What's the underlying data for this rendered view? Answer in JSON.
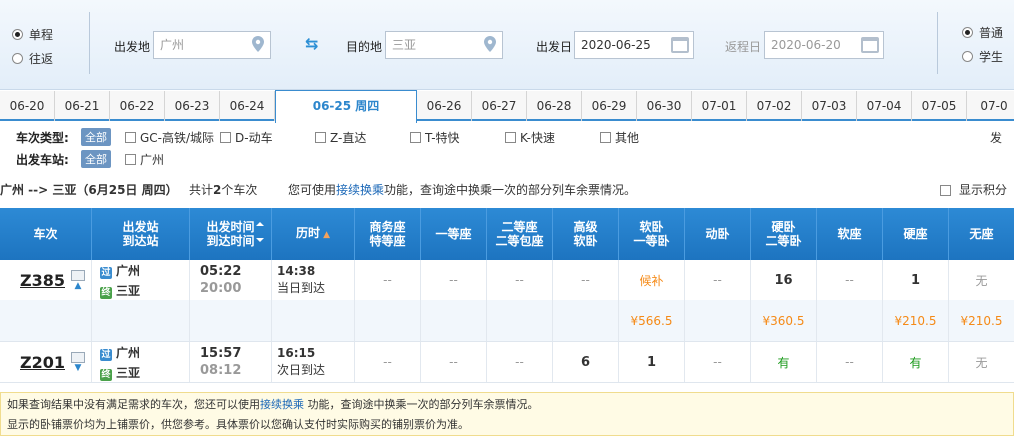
{
  "search": {
    "trip_oneway": "单程",
    "trip_round": "往返",
    "from_label": "出发地",
    "from_value": "广州",
    "to_label": "目的地",
    "to_value": "三亚",
    "depart_label": "出发日",
    "depart_value": "2020-06-25",
    "return_label": "返程日",
    "return_value": "2020-06-20",
    "type_normal": "普通",
    "type_student": "学生"
  },
  "date_tabs": [
    "06-20",
    "06-21",
    "06-22",
    "06-23",
    "06-24",
    "06-25 周四",
    "06-26",
    "06-27",
    "06-28",
    "06-29",
    "06-30",
    "07-01",
    "07-02",
    "07-03",
    "07-04",
    "07-05",
    "07-0"
  ],
  "filters": {
    "type_label": "车次类型:",
    "all": "全部",
    "types": [
      "GC-高铁/城际",
      "D-动车",
      "Z-直达",
      "T-特快",
      "K-快速",
      "其他"
    ],
    "right_cut": "发",
    "station_label": "出发车站:",
    "stations": [
      "广州"
    ]
  },
  "summary": {
    "route": "广州 --> 三亚（6月25日  周四）",
    "count_pre": "共计",
    "count": "2",
    "count_post": "个车次",
    "hint_pre": "您可使用",
    "hint_link": "接续换乘",
    "hint_post": "功能，查询途中换乘一次的部分列车余票情况。",
    "show_points": "显示积分"
  },
  "table": {
    "headers": {
      "train": "车次",
      "station1": "出发站",
      "station2": "到达站",
      "time1": "出发时间",
      "time2": "到达时间",
      "duration": "历时",
      "business1": "商务座",
      "business2": "特等座",
      "first": "一等座",
      "second1": "二等座",
      "second2": "二等包座",
      "highsoft1": "高级",
      "highsoft2": "软卧",
      "softsleep1": "软卧",
      "softsleep2": "一等卧",
      "dongwo": "动卧",
      "hardsleep1": "硬卧",
      "hardsleep2": "二等卧",
      "softseat": "软座",
      "hardseat": "硬座",
      "noseat": "无座"
    },
    "rows": [
      {
        "train": "Z385",
        "from": "广州",
        "to": "三亚",
        "dep": "05:22",
        "arr": "20:00",
        "duration": "14:38",
        "arrive_day": "当日到达",
        "business": "--",
        "first": "--",
        "second": "--",
        "highsoft": "--",
        "softsleep": "候补",
        "dongwo": "--",
        "hardsleep": "16",
        "softseat": "--",
        "hardseat": "1",
        "noseat": "无",
        "prices": {
          "softsleep": "¥566.5",
          "hardsleep": "¥360.5",
          "hardseat": "¥210.5",
          "noseat": "¥210.5"
        }
      },
      {
        "train": "Z201",
        "from": "广州",
        "to": "三亚",
        "dep": "15:57",
        "arr": "08:12",
        "duration": "16:15",
        "arrive_day": "次日到达",
        "business": "--",
        "first": "--",
        "second": "--",
        "highsoft": "6",
        "softsleep": "1",
        "dongwo": "--",
        "hardsleep": "有",
        "softseat": "--",
        "hardseat": "有",
        "noseat": "无"
      }
    ]
  },
  "notice": {
    "line1_pre": "如果查询结果中没有满足需求的车次，您还可以使用",
    "line1_link": "接续换乘",
    "line1_post": " 功能，查询途中换乘一次的部分列车余票情况。",
    "line2": "显示的卧铺票价均为上铺票价，供您参考。具体票价以您确认支付时实际购买的铺别票价为准。"
  },
  "colors": {
    "accent": "#2c86cc",
    "price": "#f58a17",
    "available": "#1a9a1a"
  }
}
